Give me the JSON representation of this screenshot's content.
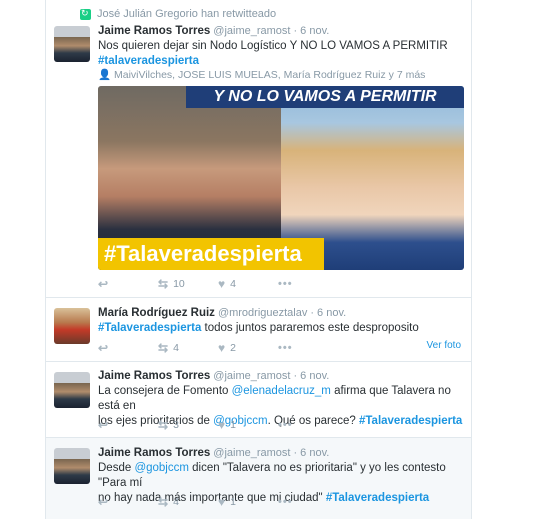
{
  "context": {
    "retweet_text": "José Julián Gregorio han retwitteado",
    "retweet_icon": "retweet-icon"
  },
  "tweets": [
    {
      "fullname": "Jaime Ramos Torres",
      "username": "@jaime_ramost",
      "dot": "·",
      "time": "6 nov.",
      "text_line1": "Nos quieren dejar sin Nodo Logístico Y NO LO VAMOS A PERMITIR",
      "hashtag": "#talaveradespierta",
      "tagged": "MaiviVilches, JOSE LUIS MUELAS, María Rodríguez Ruiz y 7 más",
      "media_banner": "Y NO LO VAMOS A PERMITIR",
      "media_hashtag": "#Talaveradespierta",
      "reply_count": "",
      "retweet_count": "10",
      "like_count": "4"
    },
    {
      "fullname": "María Rodríguez Ruiz",
      "username": "@mrodriguez­talav",
      "dot": "·",
      "time": "6 nov.",
      "hashtag": "#Talaveradespierta",
      "text_rest": " todos juntos pararemos este desproposito",
      "retweet_count": "4",
      "like_count": "2",
      "ver_foto": "Ver foto"
    },
    {
      "fullname": "Jaime Ramos Torres",
      "username": "@jaime_ramost",
      "dot": "·",
      "time": "6 nov.",
      "t1": "La consejera de Fomento ",
      "mention1": "@elenadelacruz_m",
      "t2": " afirma que Talavera no está en",
      "t3": "los ejes prioritarios de ",
      "mention2": "@gobjccm",
      "t4": ". Qué os parece? ",
      "hashtag": "#Talaveradespierta",
      "retweet_count": "3",
      "like_count": "1"
    },
    {
      "fullname": "Jaime Ramos Torres",
      "username": "@jaime_ramost",
      "dot": "·",
      "time": "6 nov.",
      "t1": "Desde ",
      "mention1": "@gobjccm",
      "t2": " dicen \"Talavera no es prioritaria\" y yo les contesto \"Para mí",
      "t3": "no hay nada más importante que mi ciudad\" ",
      "hashtag": "#Talaveradespierta",
      "retweet_count": "4",
      "like_count": "1"
    }
  ],
  "icons": {
    "reply": "reply-icon",
    "retweet": "retweet-icon",
    "like": "heart-icon",
    "more": "more-icon",
    "person": "person-icon"
  }
}
